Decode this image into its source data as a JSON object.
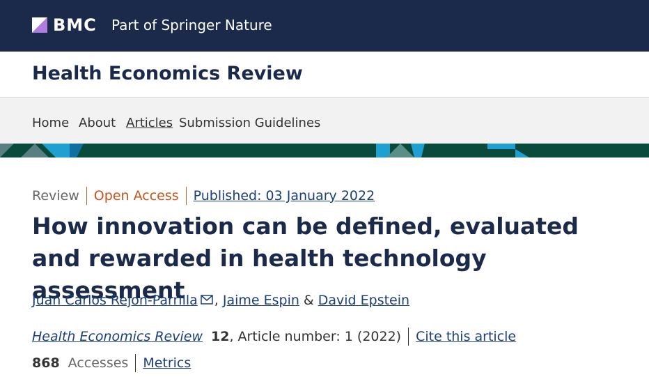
{
  "brand": {
    "logo_text": "BMC",
    "tagline": "Part of Springer Nature"
  },
  "journal": {
    "title": "Health Economics Review"
  },
  "nav": {
    "items": [
      {
        "label": "Home"
      },
      {
        "label": "About"
      },
      {
        "label": "Articles"
      },
      {
        "label": "Submission Guidelines"
      }
    ]
  },
  "article": {
    "type": "Review",
    "access": "Open Access",
    "published": "Published: 03 January 2022",
    "title": "How innovation can be defined, evaluated and rewarded in health technology assessment",
    "authors": [
      {
        "name": "Juan Carlos Rejon-Parrilla"
      },
      {
        "name": "Jaime Espin"
      },
      {
        "name": "David Epstein"
      }
    ],
    "author_sep_1": ",",
    "author_sep_2": "&",
    "citation": {
      "journal": "Health Economics Review",
      "volume": "12",
      "detail": ", Article number: 1 (2022)",
      "cite_label": "Cite this article"
    },
    "metrics": {
      "count": "868",
      "count_label": "Accesses",
      "metrics_link": "Metrics"
    }
  },
  "colors": {
    "brand_navy": "#1b2a4a",
    "link_blue": "#1b3f7a",
    "open_access_orange": "#c9541b",
    "band_green": "#0a4a3c"
  },
  "icons": {
    "logo": "bmc-logo-icon",
    "corresponding_author": "envelope-icon"
  }
}
